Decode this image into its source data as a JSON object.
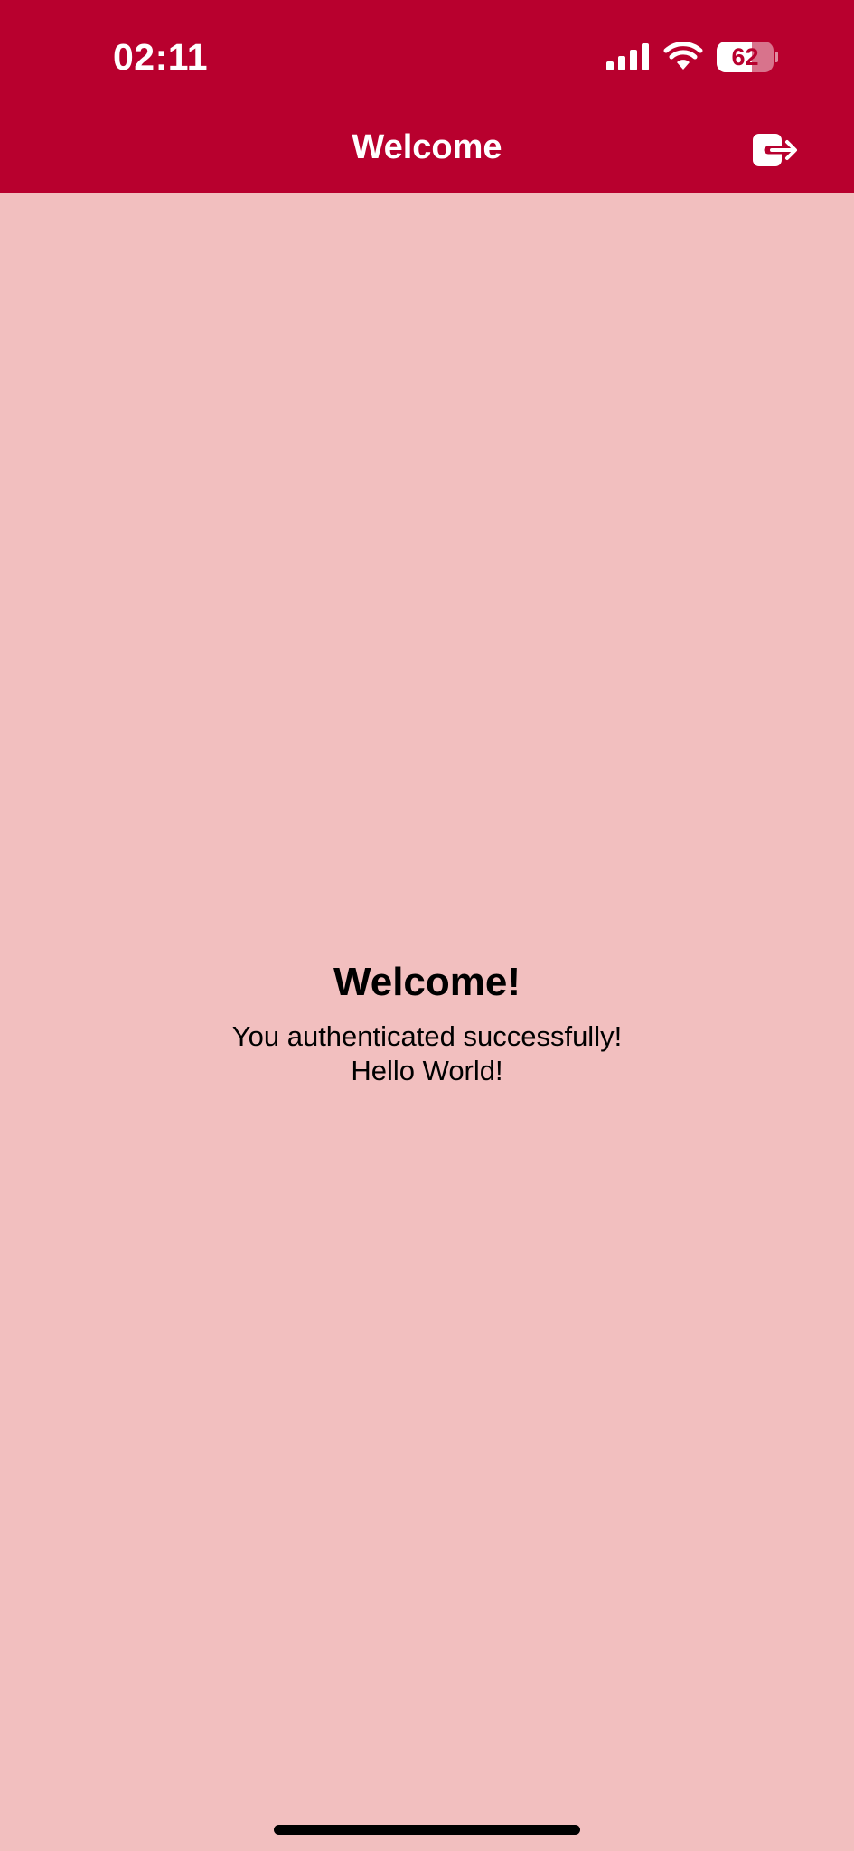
{
  "status_bar": {
    "time": "02:11",
    "battery_level": "62",
    "battery_fraction": 0.62
  },
  "nav_bar": {
    "title": "Welcome",
    "logout_icon": "logout-icon"
  },
  "main": {
    "heading": "Welcome!",
    "line1": "You authenticated successfully!",
    "line2": "Hello World!"
  },
  "colors": {
    "header_background": "#B8002E",
    "page_background": "#F2BFBF",
    "header_text": "#FFFFFF",
    "body_text": "#000000"
  }
}
